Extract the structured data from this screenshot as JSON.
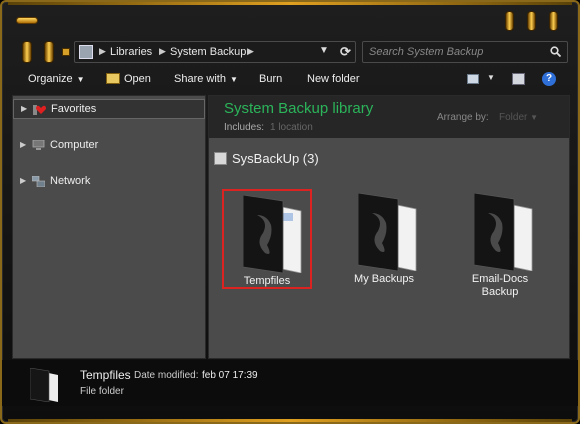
{
  "title_bar": {
    "icon": "window-menu-icon"
  },
  "address_bar": {
    "crumbs": [
      "Libraries",
      "System Backup"
    ],
    "refresh_icon": "refresh-icon",
    "search_placeholder": "Search System Backup"
  },
  "toolbar": {
    "organize": "Organize",
    "open": "Open",
    "share_with": "Share with",
    "burn": "Burn",
    "new_folder": "New folder"
  },
  "nav": {
    "items": [
      {
        "label": "Favorites",
        "icon": "favorites-icon"
      },
      {
        "label": "Computer",
        "icon": "computer-icon"
      },
      {
        "label": "Network",
        "icon": "network-icon"
      }
    ]
  },
  "library": {
    "title": "System Backup library",
    "includes_label": "Includes:",
    "includes_value": "1 location",
    "arrange_label": "Arrange by:",
    "arrange_value": "Folder"
  },
  "group": {
    "label": "SysBackUp (3)"
  },
  "folders": [
    {
      "label": "Tempfiles",
      "selected": true
    },
    {
      "label": "My Backups",
      "selected": false
    },
    {
      "label_line1": "Email-Docs",
      "label_line2": "Backup",
      "selected": false
    }
  ],
  "details": {
    "name": "Tempfiles",
    "date_label": "Date modified:",
    "date_value": "feb  07 17:39",
    "type": "File folder"
  },
  "colors": {
    "accent_gold": "#e0a020",
    "library_title": "#2bb45a",
    "selection_red": "#dd2222"
  }
}
